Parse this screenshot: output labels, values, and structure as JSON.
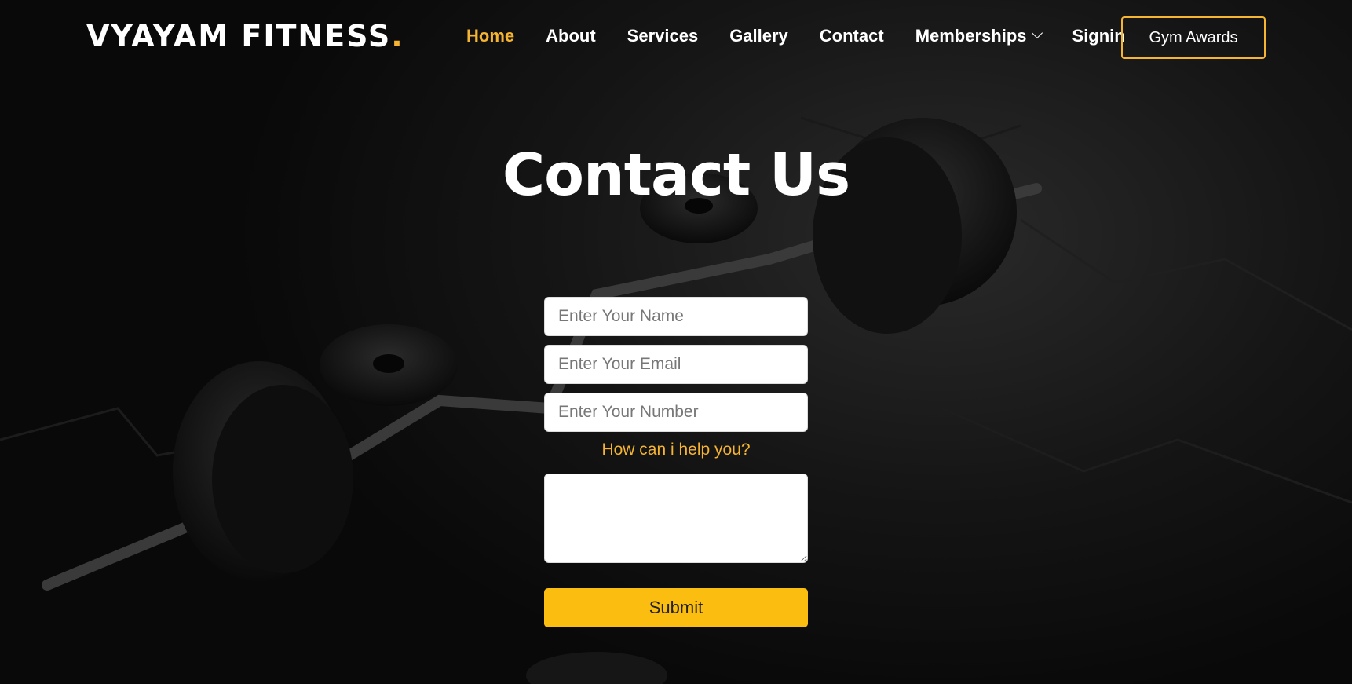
{
  "brand": {
    "name": "VYAYAM FITNESS",
    "dot": ".",
    "accent": "#f5b431"
  },
  "nav": {
    "items": [
      {
        "label": "Home",
        "active": true
      },
      {
        "label": "About"
      },
      {
        "label": "Services"
      },
      {
        "label": "Gallery"
      },
      {
        "label": "Contact"
      },
      {
        "label": "Memberships",
        "icon": "chevron-down-icon"
      },
      {
        "label": "Signin"
      }
    ],
    "cta_label": "Gym Awards"
  },
  "page": {
    "title": "Contact Us"
  },
  "form": {
    "name_placeholder": "Enter Your Name",
    "email_placeholder": "Enter Your Email",
    "number_placeholder": "Enter Your Number",
    "help_label": "How can i help you?",
    "message_value": "",
    "submit_label": "Submit",
    "submit_color": "#fcbd11"
  }
}
